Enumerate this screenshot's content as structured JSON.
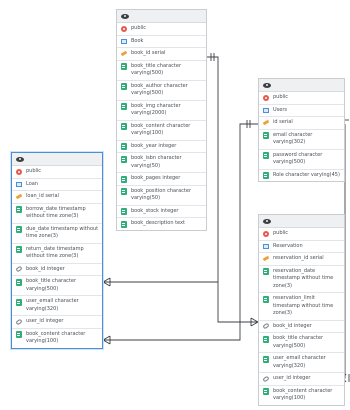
{
  "colors": {
    "edge": "#3b3f44",
    "selected_border": "#4a90d9"
  },
  "entities": {
    "book": {
      "rows": [
        {
          "icon": "schema-icon",
          "text": "public"
        },
        {
          "icon": "table-icon",
          "text": "Book"
        },
        {
          "icon": "key-icon",
          "text": "book_id serial"
        },
        {
          "icon": "column-icon",
          "text": "book_title character varying(500)"
        },
        {
          "icon": "column-icon",
          "text": "book_author character varying(500)"
        },
        {
          "icon": "column-icon",
          "text": "book_img character varying(2000)"
        },
        {
          "icon": "column-icon",
          "text": "book_content character varying(100)"
        },
        {
          "icon": "column-icon",
          "text": "book_year integer"
        },
        {
          "icon": "column-icon",
          "text": "book_isbn character varying(50)"
        },
        {
          "icon": "column-icon",
          "text": "book_pages integer"
        },
        {
          "icon": "column-icon",
          "text": "book_position character varying(50)"
        },
        {
          "icon": "column-icon",
          "text": "book_stock integer"
        },
        {
          "icon": "column-icon",
          "text": "book_description text"
        }
      ]
    },
    "users": {
      "rows": [
        {
          "icon": "schema-icon",
          "text": "public"
        },
        {
          "icon": "table-icon",
          "text": "Users"
        },
        {
          "icon": "key-icon",
          "text": "id serial"
        },
        {
          "icon": "column-icon",
          "text": "email character varying(302)"
        },
        {
          "icon": "column-icon",
          "text": "password character varying(500)"
        },
        {
          "icon": "column-icon",
          "text": "Role character varying(45)"
        }
      ]
    },
    "loan": {
      "rows": [
        {
          "icon": "schema-icon",
          "text": "public"
        },
        {
          "icon": "table-icon",
          "text": "Loan"
        },
        {
          "icon": "key-icon",
          "text": "loan_id serial"
        },
        {
          "icon": "column-icon",
          "text": "borrow_date timestamp without time zone(3)"
        },
        {
          "icon": "column-icon",
          "text": "due_date timestamp without time zone(3)"
        },
        {
          "icon": "column-icon",
          "text": "return_date timestamp without time zone(3)"
        },
        {
          "icon": "fk-icon",
          "text": "book_id integer"
        },
        {
          "icon": "column-icon",
          "text": "book_title character varying(500)"
        },
        {
          "icon": "column-icon",
          "text": "user_email character varying(320)"
        },
        {
          "icon": "fk-icon",
          "text": "user_id integer"
        },
        {
          "icon": "column-icon",
          "text": "book_content character varying(100)"
        }
      ]
    },
    "reservation": {
      "rows": [
        {
          "icon": "schema-icon",
          "text": "public"
        },
        {
          "icon": "table-icon",
          "text": "Reservation"
        },
        {
          "icon": "key-icon",
          "text": "reservation_id serial"
        },
        {
          "icon": "column-icon",
          "text": "reservation_date timestamp without time zone(3)"
        },
        {
          "icon": "column-icon",
          "text": "reservation_limit timestamp without time zone(3)"
        },
        {
          "icon": "fk-icon",
          "text": "book_id integer"
        },
        {
          "icon": "column-icon",
          "text": "book_title character varying(500)"
        },
        {
          "icon": "column-icon",
          "text": "user_email character varying(320)"
        },
        {
          "icon": "fk-icon",
          "text": "user_id integer"
        },
        {
          "icon": "column-icon",
          "text": "book_content character varying(100)"
        }
      ]
    }
  }
}
